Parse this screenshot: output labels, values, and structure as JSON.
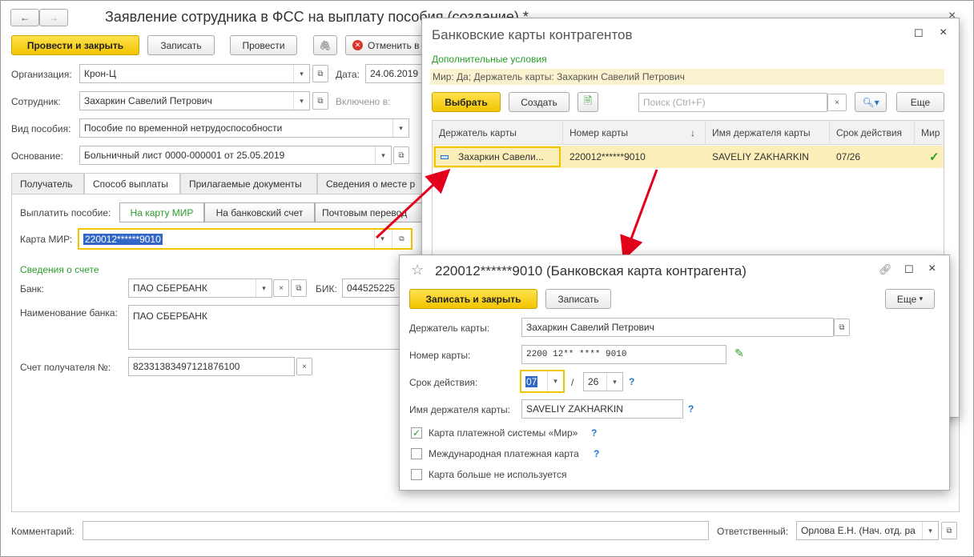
{
  "main": {
    "title": "Заявление сотрудника в ФСС на выплату пособия (создание) *",
    "nav_back": "←",
    "nav_fwd": "→",
    "close": "×",
    "toolbar": {
      "post_close": "Провести и закрыть",
      "save": "Записать",
      "post": "Провести",
      "cancel": "Отменить в"
    },
    "org_label": "Организация:",
    "org_value": "Крон-Ц",
    "date_label": "Дата:",
    "date_value": "24.06.2019",
    "emp_label": "Сотрудник:",
    "emp_value": "Захаркин Савелий Петрович",
    "included_label": "Включено в:",
    "benefit_label": "Вид пособия:",
    "benefit_value": "Пособие по временной нетрудоспособности",
    "basis_label": "Основание:",
    "basis_value": "Больничный лист 0000-000001 от 25.05.2019",
    "tabs": [
      "Получатель",
      "Способ выплаты",
      "Прилагаемые документы",
      "Сведения о месте р"
    ],
    "pay_label": "Выплатить пособие:",
    "pay_options": [
      "На карту МИР",
      "На банковский счет",
      "Почтовым перевод"
    ],
    "card_label": "Карта МИР:",
    "card_value": "220012******9010",
    "account_section": "Сведения о счете",
    "bank_label": "Банк:",
    "bank_value": "ПАО СБЕРБАНК",
    "bik_label": "БИК:",
    "bik_value": "044525225",
    "bank_name_label": "Наименование банка:",
    "bank_name_value": "ПАО СБЕРБАНК",
    "acct_label": "Счет получателя №:",
    "acct_value": "82331383497121876100",
    "comment_label": "Комментарий:",
    "resp_label": "Ответственный:",
    "resp_value": "Орлова Е.Н. (Нач. отд. ра"
  },
  "cards_window": {
    "title": "Банковские карты контрагентов",
    "section": "Дополнительные условия",
    "filter": "Мир: Да; Держатель карты: Захаркин Савелий Петрович",
    "select": "Выбрать",
    "create": "Создать",
    "search_placeholder": "Поиск (Ctrl+F)",
    "more": "Еще",
    "columns": [
      "Держатель карты",
      "Номер карты",
      "Имя держателя карты",
      "Срок действия",
      "Мир"
    ],
    "rows": [
      {
        "holder": "Захаркин Савели...",
        "number": "220012******9010",
        "name": "SAVELIY ZAKHARKIN",
        "expiry": "07/26",
        "mir": "✓"
      }
    ]
  },
  "card_window": {
    "title": "220012******9010 (Банковская карта контрагента)",
    "save_close": "Записать и закрыть",
    "save": "Записать",
    "more": "Еще",
    "holder_label": "Держатель карты:",
    "holder_value": "Захаркин Савелий Петрович",
    "number_label": "Номер карты:",
    "number_value": "2200 12** **** 9010",
    "expiry_label": "Срок действия:",
    "month": "07",
    "sep": "/",
    "year": "26",
    "name_label": "Имя держателя карты:",
    "name_value": "SAVELIY ZAKHARKIN",
    "cb1": "Карта платежной системы «Мир»",
    "cb2": "Международная платежная карта",
    "cb3": "Карта больше не используется",
    "q": "?"
  },
  "colors": {
    "accent_yellow": "#f2c500",
    "green_text": "#2a9d2a",
    "arrow_red": "#e3001b",
    "selected_row": "#fbeeb8"
  }
}
